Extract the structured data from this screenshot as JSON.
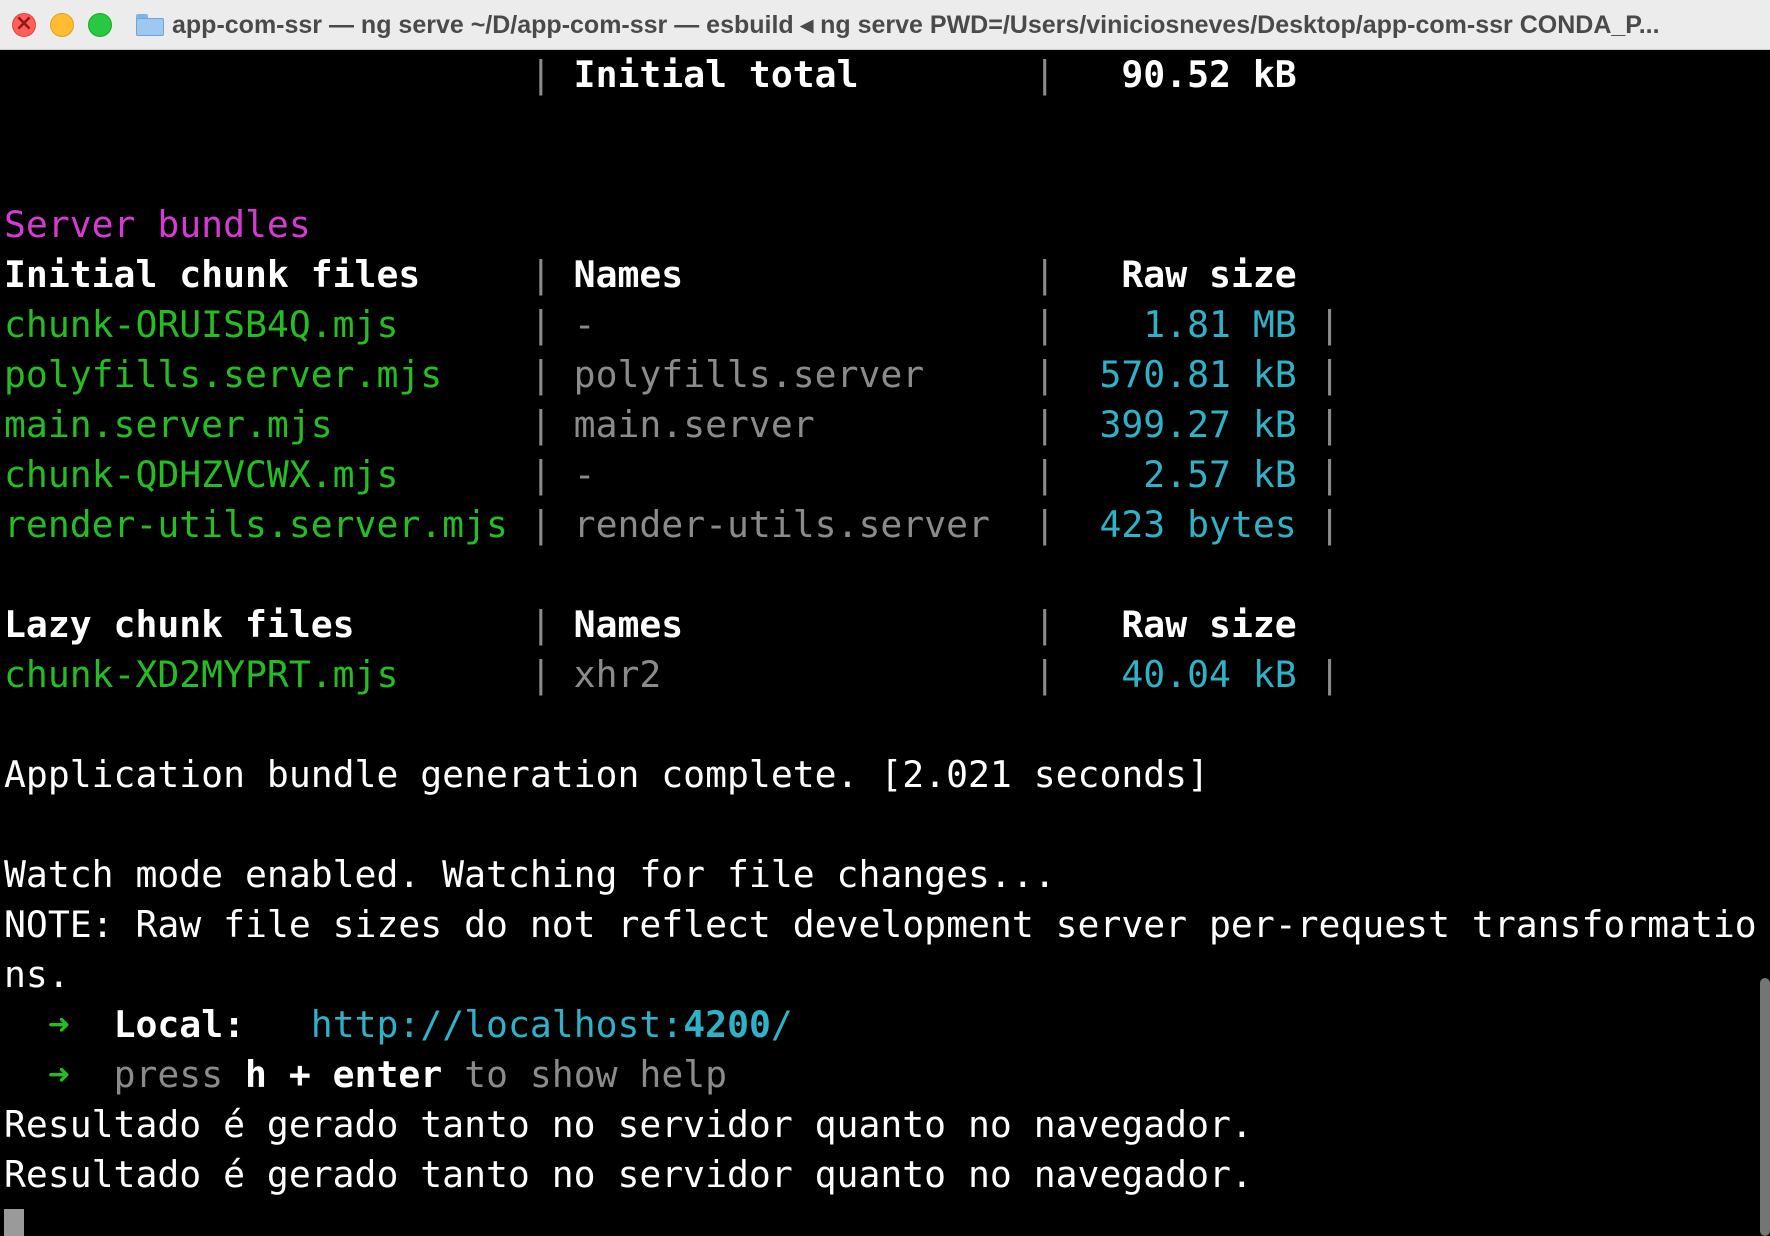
{
  "window": {
    "title": "app-com-ssr — ng serve ~/D/app-com-ssr — esbuild ◂ ng serve PWD=/Users/viniciosneves/Desktop/app-com-ssr CONDA_P..."
  },
  "colors": {
    "section_header": "#d53bd3",
    "file_name": "#25bc24",
    "chunk_name": "#8b8b8b",
    "size": "#2fb2c8",
    "background": "#000000"
  },
  "terminal": {
    "initial_total": {
      "label": "Initial total",
      "value": "90.52 kB"
    },
    "server_bundles_title": "Server bundles",
    "initial_table": {
      "headers": [
        "Initial chunk files",
        "Names",
        "Raw size"
      ],
      "rows": [
        {
          "file": "chunk-ORUISB4Q.mjs",
          "name": "-",
          "size": "1.81 MB"
        },
        {
          "file": "polyfills.server.mjs",
          "name": "polyfills.server",
          "size": "570.81 kB"
        },
        {
          "file": "main.server.mjs",
          "name": "main.server",
          "size": "399.27 kB"
        },
        {
          "file": "chunk-QDHZVCWX.mjs",
          "name": "-",
          "size": "2.57 kB"
        },
        {
          "file": "render-utils.server.mjs",
          "name": "render-utils.server",
          "size": "423 bytes"
        }
      ]
    },
    "lazy_table": {
      "headers": [
        "Lazy chunk files",
        "Names",
        "Raw size"
      ],
      "rows": [
        {
          "file": "chunk-XD2MYPRT.mjs",
          "name": "xhr2",
          "size": "40.04 kB"
        }
      ]
    },
    "complete_msg": "Application bundle generation complete. [2.021 seconds]",
    "watch_msg": "Watch mode enabled. Watching for file changes...",
    "note_line1": "NOTE: Raw file sizes do not reflect development server per-request transformatio",
    "note_line2": "ns.",
    "local": {
      "arrow": "➜",
      "label": "Local:",
      "url_prefix": "http://localhost:",
      "url_port": "4200",
      "url_suffix": "/"
    },
    "help": {
      "arrow": "➜",
      "press": "press",
      "keys": "h + enter",
      "rest": "to show help"
    },
    "result_lines": [
      "Resultado é gerado tanto no servidor quanto no navegador.",
      "Resultado é gerado tanto no servidor quanto no navegador."
    ]
  }
}
